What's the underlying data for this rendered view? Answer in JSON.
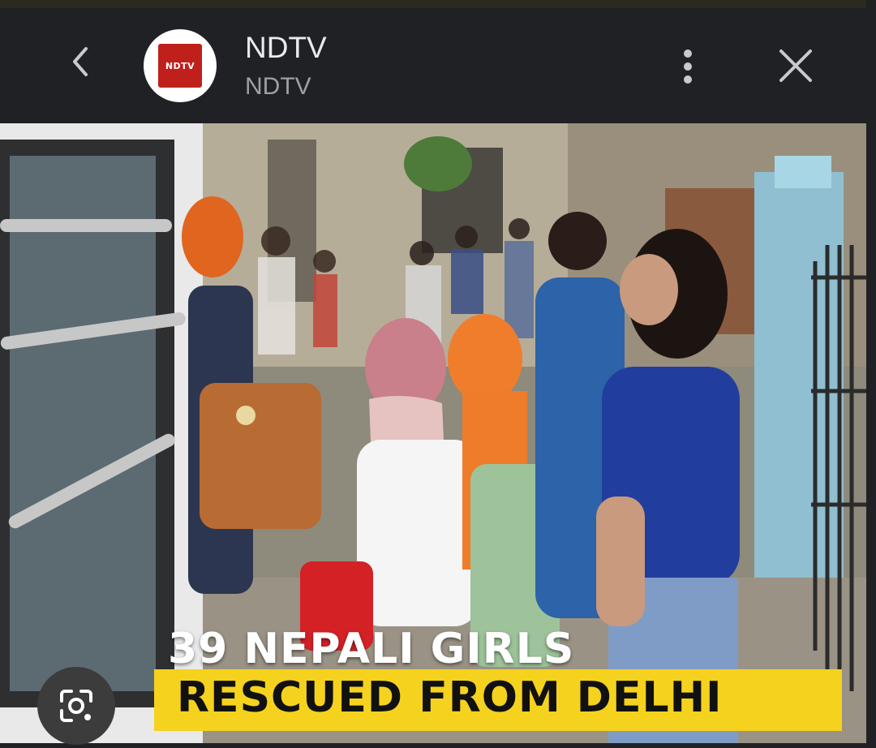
{
  "header": {
    "title": "NDTV",
    "subtitle": "NDTV",
    "logo_text": "NDTV",
    "back_icon": "chevron-left-icon",
    "more_icon": "more-vert-icon",
    "close_icon": "close-icon"
  },
  "image": {
    "caption_line1": "39 NEPALI GIRLS",
    "caption_line2": "RESCUED FROM DELHI",
    "caption_bar_color": "#f5d21e"
  },
  "lens": {
    "icon": "google-lens-icon"
  }
}
